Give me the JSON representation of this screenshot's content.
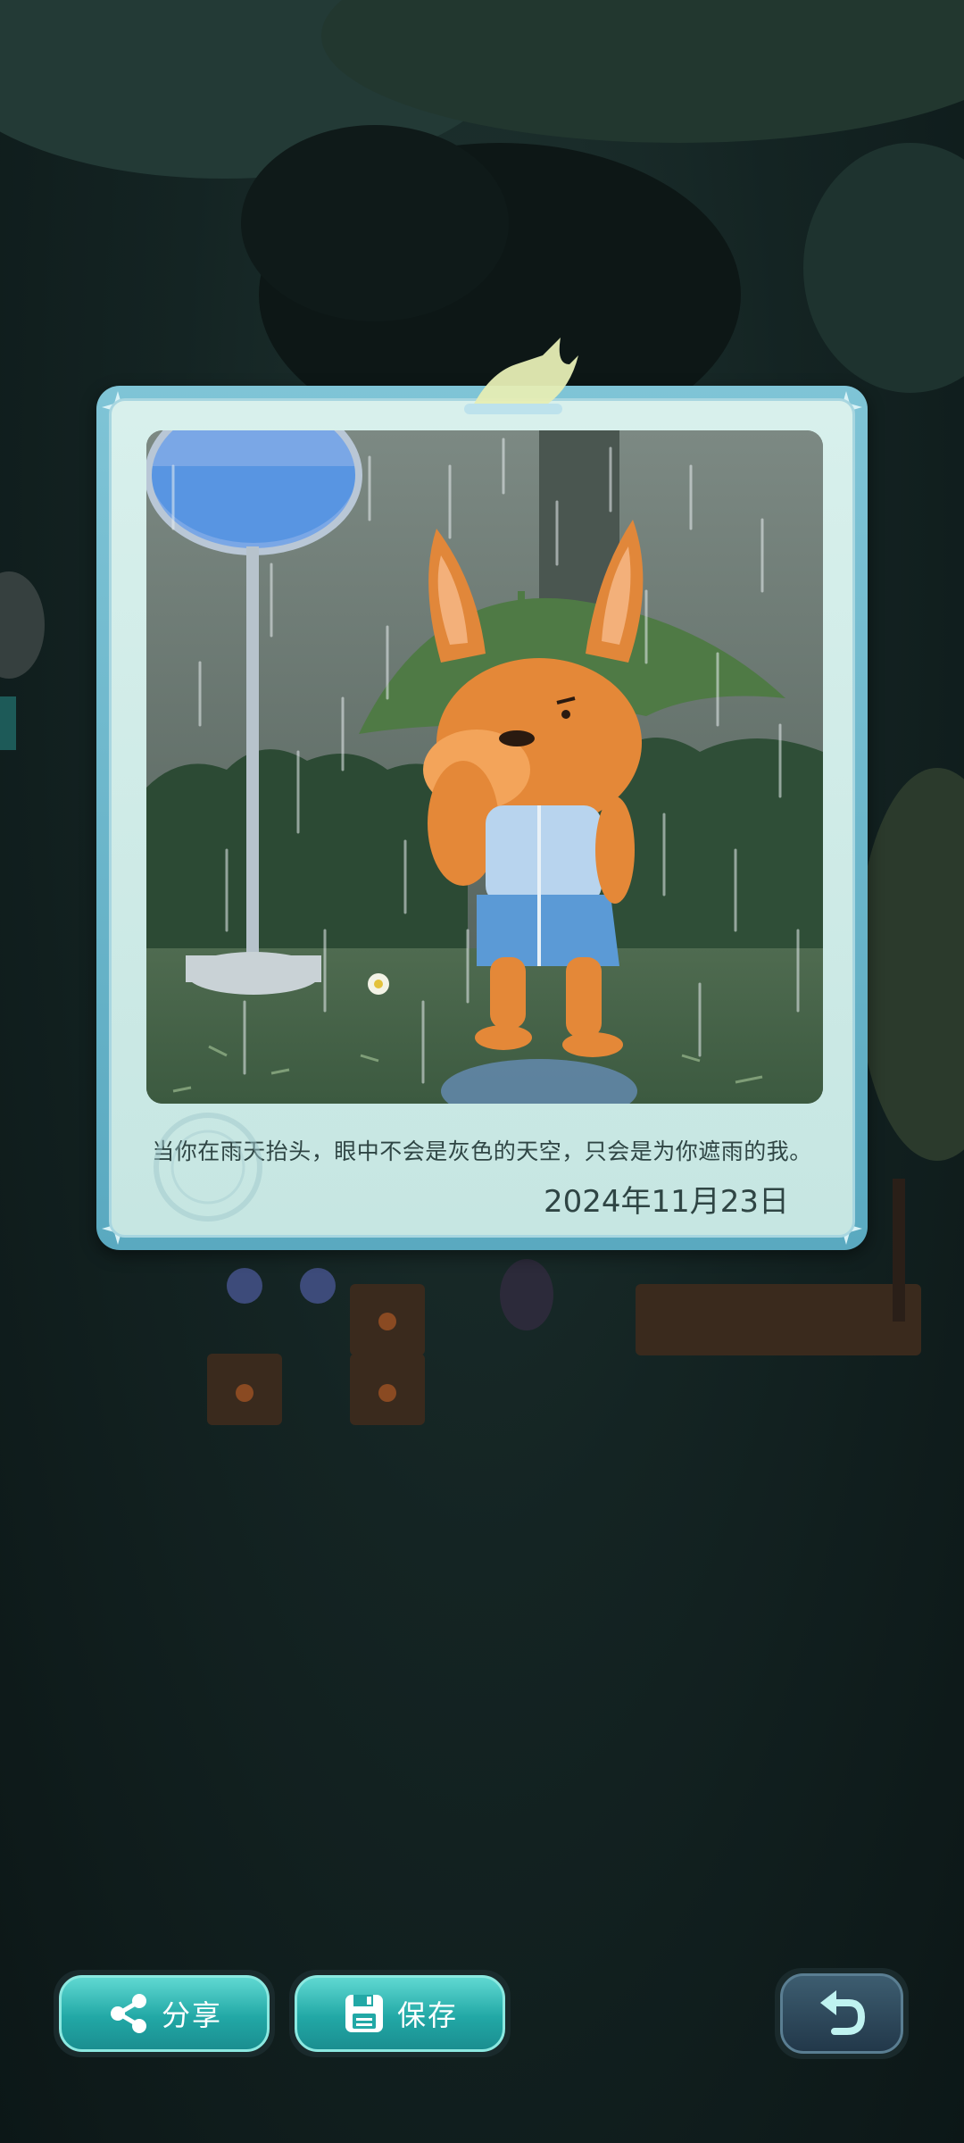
{
  "card": {
    "caption": "当你在雨天抬头，眼中不会是灰色的天空，只会是为你遮雨的我。",
    "date": "2024年11月23日"
  },
  "buttons": {
    "share_label": "分享",
    "save_label": "保存"
  },
  "icons": {
    "share": "share-icon",
    "save": "floppy-disk-icon",
    "back": "undo-arrow-icon"
  },
  "colors": {
    "frame": "#5aa9c0",
    "button_teal": "#22a8a6",
    "back_button": "#22384a"
  }
}
